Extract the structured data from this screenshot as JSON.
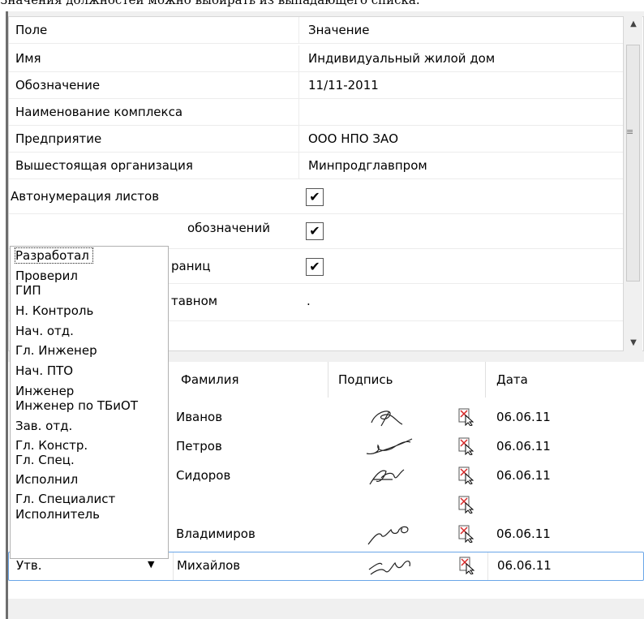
{
  "caption": "Значения должностей можно выбирать из выпадающего списка.",
  "property_grid": {
    "header": {
      "field": "Поле",
      "value": "Значение"
    },
    "rows": [
      {
        "name": "Имя",
        "value": "Индивидуальный жилой дом"
      },
      {
        "name": "Обозначение",
        "value": "11/11-2011"
      },
      {
        "name": "Наименование комплекса",
        "value": ""
      },
      {
        "name": "Предприятие",
        "value": "ООО НПО ЗАО"
      },
      {
        "name": "Вышестоящая организация",
        "value": "Минпродглавпром"
      },
      {
        "name": "Автонумерация листов",
        "checked": true
      },
      {
        "name": "Автообновление обозначений",
        "checked": true
      },
      {
        "name": "Нумерация страниц",
        "checked": true
      },
      {
        "name": "Обозначение в составном",
        "value": "."
      }
    ],
    "visible_fragments": {
      "row7_tail": "обозначений",
      "row8_tail": "раниц",
      "row9_tail": "тавном"
    }
  },
  "signature_table": {
    "headers": {
      "surname": "Фамилия",
      "signature": "Подпись",
      "date": "Дата"
    },
    "rows": [
      {
        "surname": "Иванов",
        "date": "06.06.11"
      },
      {
        "surname": "Петров",
        "date": "06.06.11"
      },
      {
        "surname": "Сидоров",
        "date": "06.06.11"
      },
      {
        "surname": "",
        "date": ""
      },
      {
        "surname": "Владимиров",
        "date": "06.06.11"
      },
      {
        "surname": "Михайлов",
        "date": "06.06.11"
      }
    ],
    "selected_row": {
      "position": "Утв."
    }
  },
  "dropdown": {
    "options": [
      "Разработал",
      "Проверил",
      "ГИП",
      "Н. Контроль",
      "Нач. отд.",
      "Гл. Инженер",
      "Нач. ПТО",
      "Инженер",
      "Инженер по ТБиОТ",
      "Зав. отд.",
      "Гл. Констр.",
      "Гл. Спец.",
      "Исполнил",
      "Гл. Специалист",
      "Исполнитель"
    ],
    "focused": "Разработал"
  },
  "colors": {
    "selection_border": "#6aa6e8",
    "checkbox_border": "#555555",
    "clear_icon_red": "#d62828"
  },
  "icons": {
    "checkbox": "check-icon",
    "clear_signature": "clear-signature-icon",
    "dropdown_arrow": "chevron-down-icon"
  }
}
